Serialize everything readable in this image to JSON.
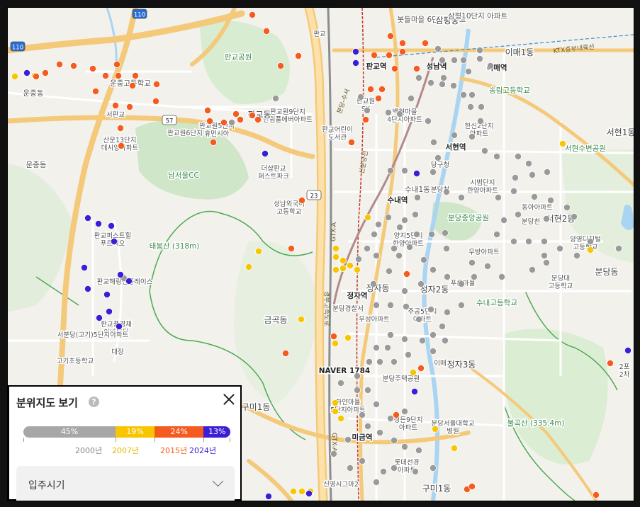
{
  "map": {
    "place_labels": [
      {
        "text": "봇들마을 6단지아파트"
      },
      {
        "text": "삼평동"
      },
      {
        "text": "삼평10단지 아파트"
      },
      {
        "text": "판교"
      },
      {
        "text": "판교공원"
      },
      {
        "text": "판교역"
      },
      {
        "text": "성남역"
      },
      {
        "text": "이매1동"
      },
      {
        "text": "이매역"
      },
      {
        "text": "운중고등학교"
      },
      {
        "text": "운중동"
      },
      {
        "text": "판교원9단지 한림풀에버아파트"
      },
      {
        "text": "판교동"
      },
      {
        "text": "판교원5단지 휴먼시아"
      },
      {
        "text": "판교원6단지"
      },
      {
        "text": "판교원 SK"
      },
      {
        "text": "백현마을 4단지아파트"
      },
      {
        "text": "판교어린이 도서관"
      },
      {
        "text": "한신2단지 아파트"
      },
      {
        "text": "송림고등학교"
      },
      {
        "text": "서현1동"
      },
      {
        "text": "서판교"
      },
      {
        "text": "산운13단지 데시앙아파트"
      },
      {
        "text": "더샵판교 퍼스트파크"
      },
      {
        "text": "남서울CC"
      },
      {
        "text": "서현역"
      },
      {
        "text": "서현수변공원"
      },
      {
        "text": "당구청"
      },
      {
        "text": "시범단지 한양아파트"
      },
      {
        "text": "운중동"
      },
      {
        "text": "성남외국어 고등학교"
      },
      {
        "text": "수내1동"
      },
      {
        "text": "분당천"
      },
      {
        "text": "수내역"
      },
      {
        "text": "분당중앙공원"
      },
      {
        "text": "동아아파트"
      },
      {
        "text": "서현2동"
      },
      {
        "text": "판교퍼스트힐 푸르지오"
      },
      {
        "text": "태봉산 (318m)"
      },
      {
        "text": "양지5단지 한양아파트"
      },
      {
        "text": "분당천"
      },
      {
        "text": "양영디지털 고등학교"
      },
      {
        "text": "우방아파트"
      },
      {
        "text": "판교해링턴플레이스"
      },
      {
        "text": "정자동"
      },
      {
        "text": "정자역"
      },
      {
        "text": "정자2동"
      },
      {
        "text": "푸른마을"
      },
      {
        "text": "분당대 고등학교"
      },
      {
        "text": "분당동"
      },
      {
        "text": "분당경찰서"
      },
      {
        "text": "주공5단지 아파트"
      },
      {
        "text": "수내고등학교"
      },
      {
        "text": "금곡동"
      },
      {
        "text": "판교풍경채 어바니티"
      },
      {
        "text": "서분당(고기)5단지아파트"
      },
      {
        "text": "우성아파트"
      },
      {
        "text": "대장"
      },
      {
        "text": "고기초등학교"
      },
      {
        "text": "NAVER 1784"
      },
      {
        "text": "정자3동"
      },
      {
        "text": "이매"
      },
      {
        "text": "분당주택공원"
      },
      {
        "text": "구미1동"
      },
      {
        "text": "하얀마을 5단지아파트"
      },
      {
        "text": "정든9단지 아파트"
      },
      {
        "text": "미금역"
      },
      {
        "text": "분당서울대학교 병원"
      },
      {
        "text": "불곡산 (335.4m)"
      },
      {
        "text": "롯데선경 아파트"
      },
      {
        "text": "구미1동"
      },
      {
        "text": "신영시그마2"
      },
      {
        "text": "2포 2차"
      }
    ],
    "road_shields": [
      "110",
      "110",
      "57",
      "23"
    ],
    "road_labels": [
      "GTX-A",
      "신분당선",
      "KTX중부내륙선",
      "GTX-A",
      "경부고속도로",
      "분당-수서"
    ],
    "marker_colors": {
      "gray": "#9a9a9a",
      "yellow": "#f7c600",
      "orange": "#f55a1e",
      "blue": "#3b1fd6"
    }
  },
  "legend": {
    "title": "분위지도 보기",
    "help_icon": "?",
    "segments": [
      {
        "label": "45%",
        "value": 45,
        "color": "#a7a7a7"
      },
      {
        "label": "19%",
        "value": 19,
        "color": "#f7c600"
      },
      {
        "label": "24%",
        "value": 24,
        "color": "#f55a1e"
      },
      {
        "label": "13%",
        "value": 13,
        "color": "#3b1fd6"
      }
    ],
    "years": [
      {
        "label": "2000년",
        "color": "#888888"
      },
      {
        "label": "2007년",
        "color": "#e8b800"
      },
      {
        "label": "2015년",
        "color": "#f55a1e"
      },
      {
        "label": "2024년",
        "color": "#3b1fd6"
      }
    ],
    "dropdown_label": "입주시기"
  }
}
